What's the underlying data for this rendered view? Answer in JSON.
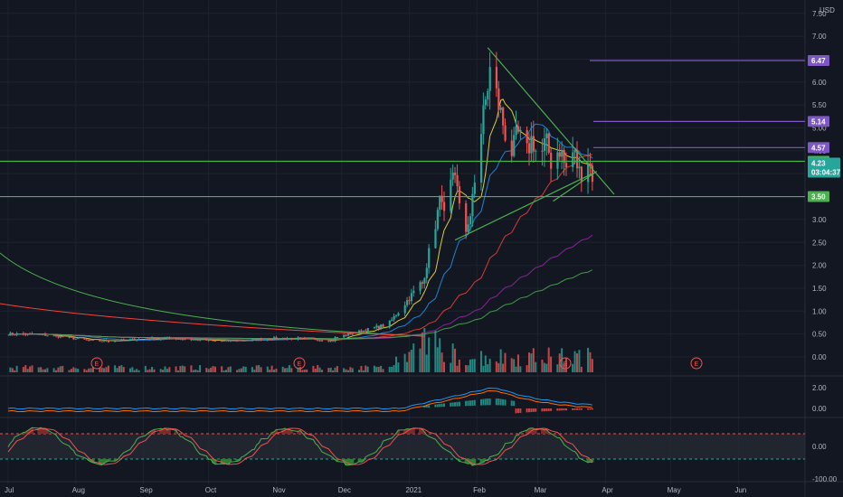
{
  "currency": "USD",
  "chart_data": {
    "type": "candlestick",
    "x_labels": [
      "Jul",
      "Aug",
      "Sep",
      "Oct",
      "Nov",
      "Dec",
      "2021",
      "Feb",
      "Mar",
      "Apr",
      "May",
      "Jun"
    ],
    "y_ticks": [
      "7.50",
      "7.00",
      "6.50",
      "6.00",
      "5.50",
      "5.00",
      "4.50",
      "4.00",
      "3.50",
      "3.00",
      "2.50",
      "2.00",
      "1.50",
      "1.00",
      "0.50",
      "0.00"
    ],
    "ylim": [
      -0.3,
      7.6
    ],
    "price_tags": [
      {
        "label": "6.47",
        "value": 6.47,
        "color": "#7e57c2"
      },
      {
        "label": "5.14",
        "value": 5.14,
        "color": "#7e57c2"
      },
      {
        "label": "4.57",
        "value": 4.57,
        "color": "#7e57c2"
      },
      {
        "label": "4.27",
        "value": 4.27,
        "color": "#4caf50"
      },
      {
        "label": "3.50",
        "value": 3.5,
        "color": "#4caf50"
      }
    ],
    "last_price": {
      "label": "4.23",
      "countdown": "03:04:37",
      "value": 4.23,
      "color": "#26a69a"
    },
    "horizontal_lines": [
      {
        "value": 4.27,
        "color": "#4caf50"
      },
      {
        "value": 3.5,
        "color": "#4caf50"
      }
    ],
    "resistance_rays": [
      {
        "value": 6.47,
        "color": "#7e57c2"
      },
      {
        "value": 5.14,
        "color": "#7e57c2"
      },
      {
        "value": 4.57,
        "color": "#7e57c2"
      }
    ],
    "earnings_markers": [
      "E",
      "E",
      "E",
      "E"
    ],
    "indicator1_ticks": [
      "2.00",
      "0.00"
    ],
    "indicator2_ticks": [
      "0.00",
      "-100.00"
    ],
    "grid": true
  }
}
